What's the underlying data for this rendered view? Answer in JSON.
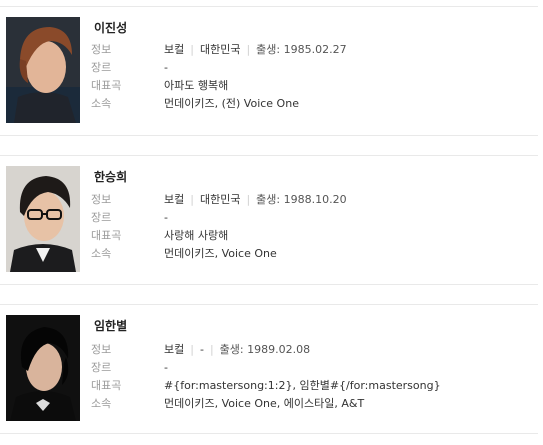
{
  "artists": [
    {
      "name": "이진성",
      "labels": {
        "info": "정보",
        "genre": "장르",
        "song": "대표곡",
        "agency": "소속"
      },
      "info": {
        "role": "보컬",
        "country": "대한민국",
        "birth": "출생: 1985.02.27"
      },
      "genre": "-",
      "song": "아파도 행복해",
      "agency": "먼데이키즈, (전) Voice One"
    },
    {
      "name": "한승희",
      "labels": {
        "info": "정보",
        "genre": "장르",
        "song": "대표곡",
        "agency": "소속"
      },
      "info": {
        "role": "보컬",
        "country": "대한민국",
        "birth": "출생: 1988.10.20"
      },
      "genre": "-",
      "song": "사랑해 사랑해",
      "agency": "먼데이키즈, Voice One"
    },
    {
      "name": "임한별",
      "labels": {
        "info": "정보",
        "genre": "장르",
        "song": "대표곡",
        "agency": "소속"
      },
      "info": {
        "role": "보컬",
        "country": "-",
        "birth": "출생: 1989.02.08"
      },
      "genre": "-",
      "song": "#{for:mastersong:1:2}, 임한별#{/for:mastersong}",
      "agency": "먼데이키즈, Voice One, 에이스타일, A&T"
    }
  ]
}
